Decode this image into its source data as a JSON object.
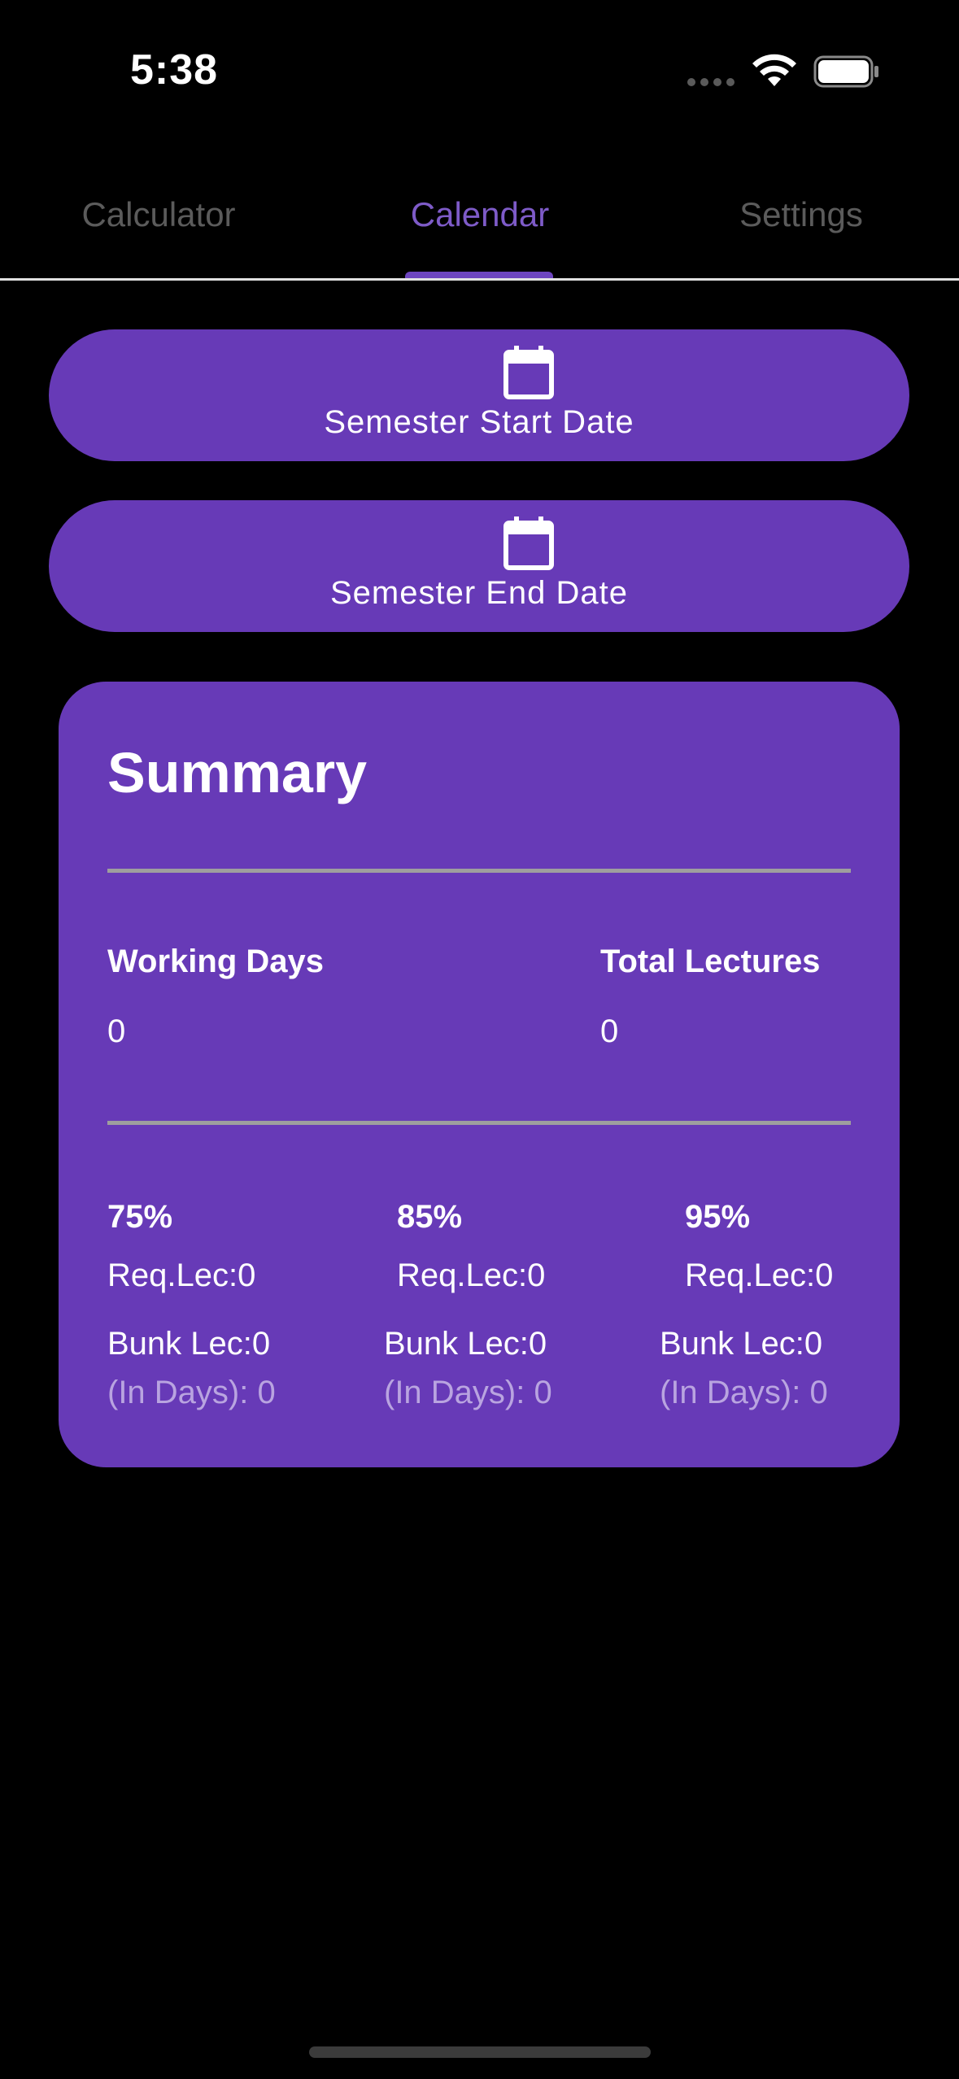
{
  "status_bar": {
    "time": "5:38"
  },
  "tabs": [
    {
      "label": "Calculator",
      "active": false
    },
    {
      "label": "Calendar",
      "active": true
    },
    {
      "label": "Settings",
      "active": false
    }
  ],
  "date_buttons": {
    "start_label": "Semester Start Date",
    "end_label": "Semester End Date",
    "icon": "calendar-icon"
  },
  "summary": {
    "title": "Summary",
    "working_days": {
      "label": "Working Days",
      "value": "0"
    },
    "total_lectures": {
      "label": "Total Lectures",
      "value": "0"
    },
    "targets": [
      {
        "percent": "75%",
        "req_lec": "Req.Lec:0",
        "bunk_lec": "Bunk Lec:0",
        "in_days": "(In Days): 0"
      },
      {
        "percent": "85%",
        "req_lec": "Req.Lec:0",
        "bunk_lec": "Bunk Lec:0",
        "in_days": "(In Days): 0"
      },
      {
        "percent": "95%",
        "req_lec": "Req.Lec:0",
        "bunk_lec": "Bunk Lec:0",
        "in_days": "(In Days): 0"
      }
    ]
  },
  "colors": {
    "background": "#000000",
    "accent": "#673ab7",
    "active_tab": "#7e5bc8",
    "inactive_tab": "#5b5b5b",
    "divider": "#9e9e9e",
    "muted_text": "#b9a4e0"
  }
}
